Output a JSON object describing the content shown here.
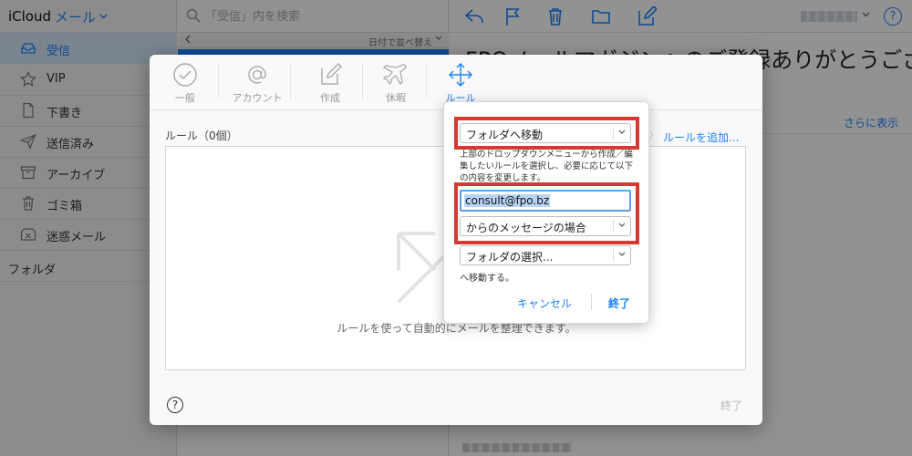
{
  "app": {
    "brand": "iCloud",
    "name": "メール"
  },
  "sidebar": {
    "items": [
      {
        "label": "受信",
        "icon": "inbox-icon"
      },
      {
        "label": "VIP",
        "icon": "star-icon"
      },
      {
        "label": "下書き",
        "icon": "document-icon"
      },
      {
        "label": "送信済み",
        "icon": "send-icon"
      },
      {
        "label": "アーカイブ",
        "icon": "archive-icon"
      },
      {
        "label": "ゴミ箱",
        "icon": "trash-icon"
      },
      {
        "label": "迷惑メール",
        "icon": "junk-icon"
      }
    ],
    "folders_label": "フォルダ"
  },
  "list": {
    "search_placeholder": "「受信」内を検索",
    "sort_label": "日付で並べ替え"
  },
  "reader": {
    "subject": "FPOメールマガジンへのご登録ありがとうござ",
    "more_link": "さらに表示",
    "help": "?"
  },
  "prefs": {
    "tabs": [
      {
        "label": "一般",
        "icon": "check-circle-icon"
      },
      {
        "label": "アカウント",
        "icon": "at-icon"
      },
      {
        "label": "作成",
        "icon": "compose-icon"
      },
      {
        "label": "休暇",
        "icon": "airplane-icon"
      },
      {
        "label": "ルール",
        "icon": "rules-arrows-icon"
      }
    ],
    "active_tab": "ルール",
    "rules_label": "ルール（0個）",
    "add_rule": "ルールを追加...",
    "empty_hint": "ルールを使って自動的にメールを整理できます。",
    "help": "?",
    "done": "終了"
  },
  "rule_editor": {
    "action": "フォルダへ移動",
    "description": "上部のドロップダウンメニューから作成／編集したいルールを選択し、必要に応じて以下の内容を変更します。",
    "email_value": "consult@fpo.bz",
    "condition": "からのメッセージの場合",
    "folder_select": "フォルダの選択...",
    "move_to": "へ移動する。",
    "cancel": "キャンセル",
    "done": "終了"
  },
  "colors": {
    "accent": "#1a82fb",
    "highlight_red": "#d43a2f",
    "selection_blue": "#b9d5f6"
  }
}
